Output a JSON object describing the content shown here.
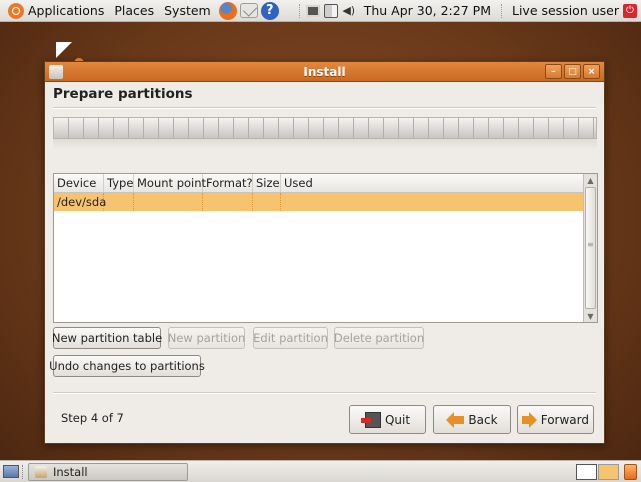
{
  "top_panel": {
    "applications": "Applications",
    "places": "Places",
    "system": "System",
    "clock": "Thu Apr 30,  2:27 PM",
    "user": "Live session user",
    "launchers": [
      "firefox-icon",
      "mail-icon",
      "help-icon"
    ],
    "help_glyph": "?"
  },
  "window": {
    "title": "Install",
    "buttons": {
      "minimize": "–",
      "maximize": "□",
      "close": "×"
    },
    "heading": "Prepare partitions",
    "table": {
      "columns": [
        "Device",
        "Type",
        "Mount point",
        "Format?",
        "Size",
        "Used"
      ],
      "rows": [
        {
          "device": "/dev/sda",
          "type": "",
          "mount_point": "",
          "format": "",
          "size": "",
          "used": "",
          "selected": true
        }
      ]
    },
    "buttons_row1": {
      "new_partition_table": "New partition table",
      "new_partition": "New partition",
      "edit_partition": "Edit partition",
      "delete_partition": "Delete partition"
    },
    "undo": "Undo changes to partitions",
    "step": "Step 4 of 7",
    "nav": {
      "quit": "Quit",
      "back": "Back",
      "forward": "Forward"
    }
  },
  "bottom_panel": {
    "taskbar_item": "Install"
  },
  "colors": {
    "accent": "#d67a2f",
    "selection": "#f7c36f",
    "desktop": "#6b3a1a"
  }
}
